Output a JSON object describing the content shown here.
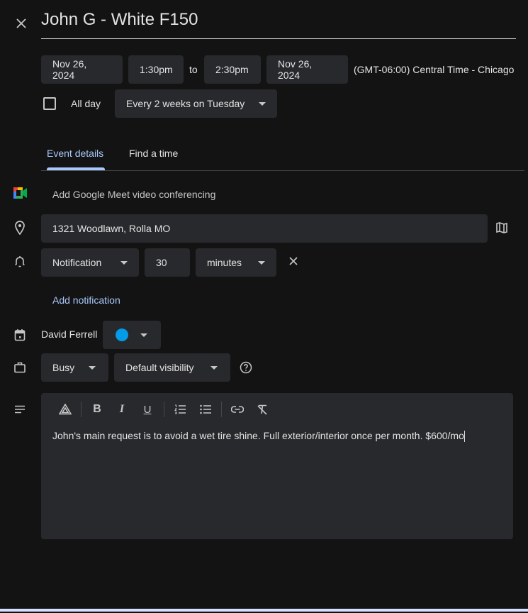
{
  "event": {
    "title": "John G - White F150",
    "start_date": "Nov 26, 2024",
    "start_time": "1:30pm",
    "to_label": "to",
    "end_time": "2:30pm",
    "end_date": "Nov 26, 2024",
    "timezone": "(GMT-06:00) Central Time - Chicago",
    "all_day_label": "All day",
    "all_day_checked": false,
    "recurrence": "Every 2 weeks on Tuesday"
  },
  "tabs": [
    {
      "label": "Event details",
      "active": true
    },
    {
      "label": "Find a time",
      "active": false
    }
  ],
  "meet": {
    "label": "Add Google Meet video conferencing"
  },
  "location": {
    "value": "1321 Woodlawn, Rolla MO"
  },
  "notification": {
    "type": "Notification",
    "amount": "30",
    "unit": "minutes",
    "add_label": "Add notification"
  },
  "calendar": {
    "owner": "David Ferrell",
    "color": "#039be5"
  },
  "availability": {
    "status": "Busy",
    "visibility": "Default visibility"
  },
  "description": {
    "toolbar": [
      "drive-icon",
      "bold-icon",
      "italic-icon",
      "underline-icon",
      "numbered-list-icon",
      "bulleted-list-icon",
      "link-icon",
      "clear-formatting-icon"
    ],
    "text": "John's main request is to avoid a wet tire shine. Full exterior/interior once per month. $600/mo"
  },
  "colors": {
    "background": "#131313",
    "field": "#28292c",
    "accent": "#a8c7fa"
  }
}
